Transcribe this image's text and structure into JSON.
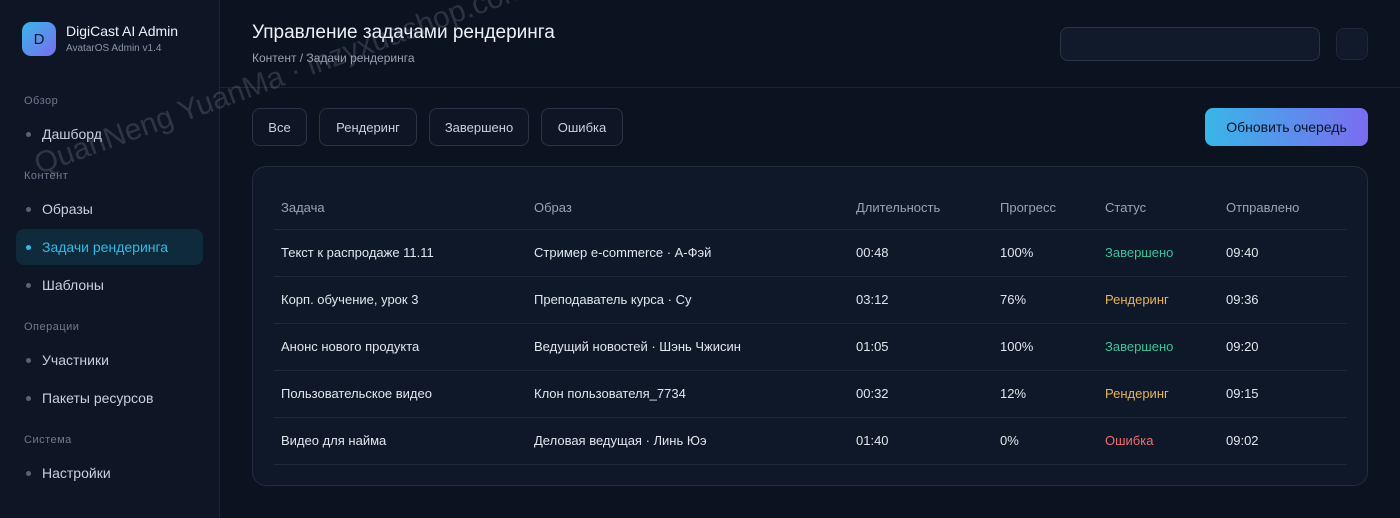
{
  "brand": {
    "logo_letter": "D",
    "name": "DigiCast AI Admin",
    "subtitle": "AvatarOS Admin v1.4"
  },
  "sidebar": {
    "sections": [
      {
        "label": "Обзор",
        "items": [
          {
            "label": "Дашборд"
          }
        ]
      },
      {
        "label": "Контент",
        "items": [
          {
            "label": "Образы"
          },
          {
            "label": "Задачи рендеринга",
            "active": true
          },
          {
            "label": "Шаблоны"
          }
        ]
      },
      {
        "label": "Операции",
        "items": [
          {
            "label": "Участники"
          },
          {
            "label": "Пакеты ресурсов"
          }
        ]
      },
      {
        "label": "Система",
        "items": [
          {
            "label": "Настройки"
          }
        ]
      }
    ]
  },
  "header": {
    "title": "Управление задачами рендеринга",
    "breadcrumb": "Контент / Задачи рендеринга",
    "search_value": "",
    "search_placeholder": ""
  },
  "filters": {
    "all": "Все",
    "rendering": "Рендеринг",
    "done": "Завершено",
    "error": "Ошибка"
  },
  "actions": {
    "refresh": "Обновить очередь"
  },
  "table": {
    "columns": [
      "Задача",
      "Образ",
      "Длительность",
      "Прогресс",
      "Статус",
      "Отправлено"
    ],
    "rows": [
      [
        "Текст к распродаже 11.11",
        "Стример e-commerce · А-Фэй",
        "00:48",
        "100%",
        "Завершено",
        "09:40"
      ],
      [
        "Корп. обучение, урок 3",
        "Преподаватель курса · Су",
        "03:12",
        "76%",
        "Рендеринг",
        "09:36"
      ],
      [
        "Анонс нового продукта",
        "Ведущий новостей · Шэнь Чжисин",
        "01:05",
        "100%",
        "Завершено",
        "09:20"
      ],
      [
        "Пользовательское видео",
        "Клон пользователя_7734",
        "00:32",
        "12%",
        "Рендеринг",
        "09:15"
      ],
      [
        "Видео для найма",
        "Деловая ведущая · Линь Юэ",
        "01:40",
        "0%",
        "Ошибка",
        "09:02"
      ]
    ]
  },
  "colors": {
    "accent": "#37b8e6",
    "gradient_end": "#7a6cf0",
    "done": "#3fc39a",
    "rendering": "#e8b25c",
    "error": "#ee6e6e"
  },
  "watermark": "QuanNeng YuanMa · inzyxuashop.com"
}
